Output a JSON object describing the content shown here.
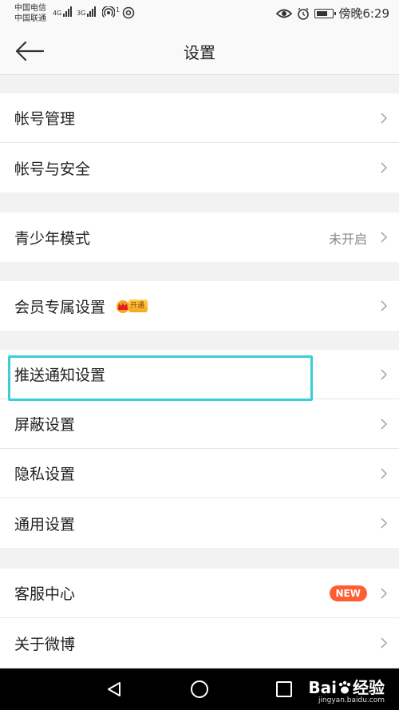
{
  "status_bar": {
    "carrier_1": "中国电信",
    "carrier_2": "中国联通",
    "net_1": "4G",
    "net_2": "3G",
    "hotspot_count": "1",
    "time": "傍晚6:29",
    "battery_level": 0.7
  },
  "nav": {
    "title": "设置"
  },
  "groups": [
    {
      "items": [
        {
          "label": "帐号管理"
        },
        {
          "label": "帐号与安全"
        }
      ]
    },
    {
      "items": [
        {
          "label": "青少年模式",
          "value": "未开启"
        }
      ]
    },
    {
      "items": [
        {
          "label": "会员专属设置",
          "badge": "开通"
        }
      ]
    },
    {
      "items": [
        {
          "label": "推送通知设置"
        },
        {
          "label": "屏蔽设置"
        },
        {
          "label": "隐私设置"
        },
        {
          "label": "通用设置"
        }
      ]
    },
    {
      "items": [
        {
          "label": "客服中心",
          "badge": "NEW"
        },
        {
          "label": "关于微博"
        }
      ]
    }
  ],
  "watermark": {
    "brand": "Bai",
    "brand_suffix": "经验",
    "url": "jingyan.baidu.com"
  },
  "colors": {
    "highlight": "#38d0d6",
    "new_badge": "#ff5e32",
    "vip_gold": "#f5a623"
  },
  "icons": [
    "back-arrow-icon",
    "chevron-right-icon",
    "crown-icon",
    "eye-icon",
    "alarm-icon",
    "battery-icon",
    "hotspot-icon",
    "triangle-back-icon",
    "circle-home-icon",
    "square-recent-icon",
    "paw-icon"
  ]
}
